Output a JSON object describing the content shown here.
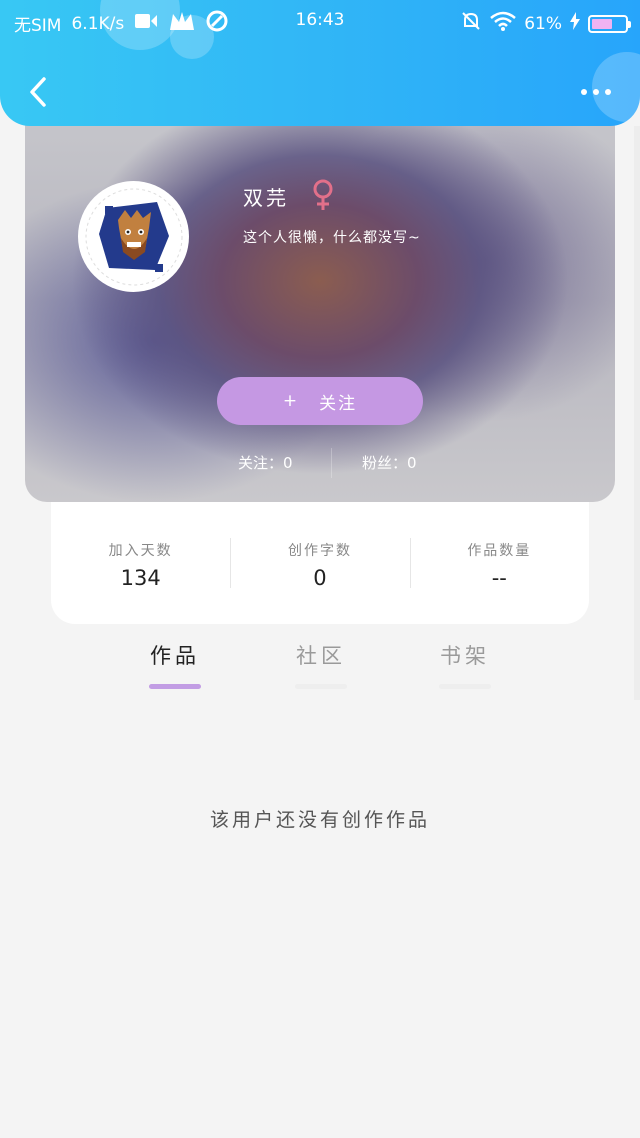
{
  "status_bar": {
    "carrier": "无SIM",
    "speed": "6.1K/s",
    "time": "16:43",
    "battery": "61%",
    "battery_level": 0.61
  },
  "profile": {
    "name": "双芫",
    "gender_symbol": "♀",
    "bio": "这个人很懒，什么都没写~",
    "follow_plus": "+",
    "follow_label": "关注",
    "following_text": "关注：0",
    "fans_text": "粉丝：0"
  },
  "summary": [
    {
      "label": "加入天数",
      "value": "134"
    },
    {
      "label": "创作字数",
      "value": "0"
    },
    {
      "label": "作品数量",
      "value": "--"
    }
  ],
  "tabs": [
    {
      "label": "作品",
      "active": true
    },
    {
      "label": "社区",
      "active": false
    },
    {
      "label": "书架",
      "active": false
    }
  ],
  "empty_message": "该用户还没有创作作品",
  "colors": {
    "header_gradient_start": "#38c8f4",
    "header_gradient_end": "#27a5fb",
    "accent_purple": "#c598e3",
    "gender_pink": "#e2708a",
    "battery_fill": "#f0b3f2"
  }
}
